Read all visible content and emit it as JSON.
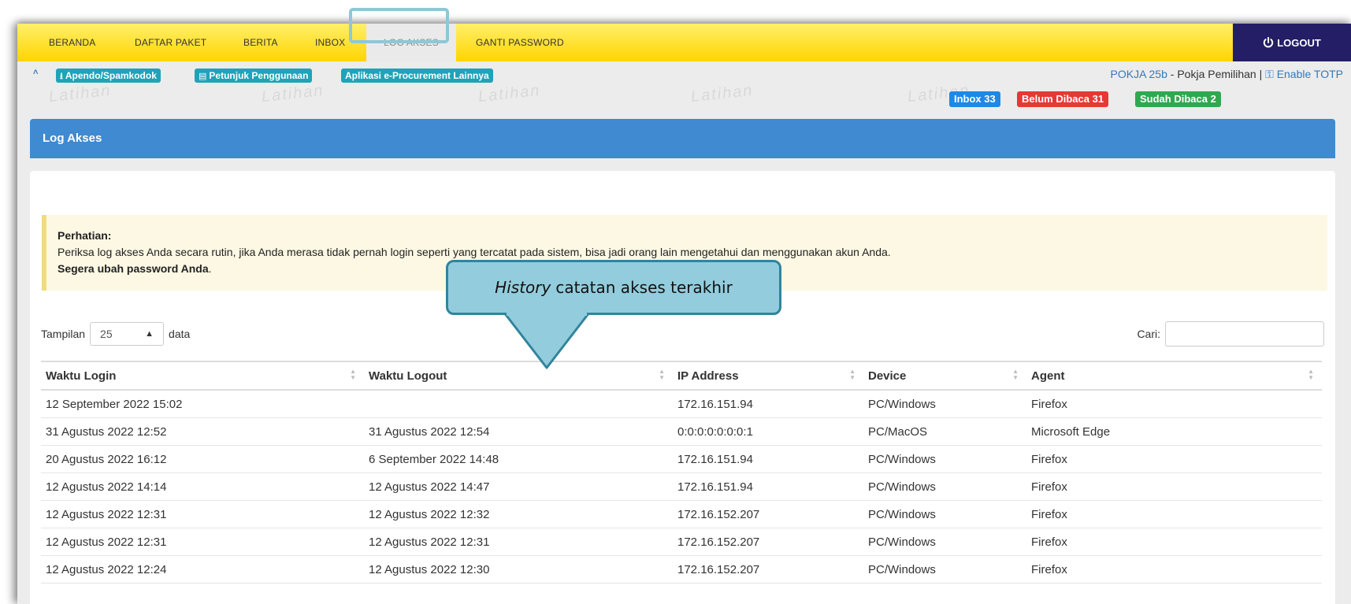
{
  "nav": {
    "items": [
      "BERANDA",
      "DAFTAR PAKET",
      "BERITA",
      "INBOX",
      "LOG AKSES",
      "GANTI PASSWORD"
    ],
    "logout": "LOGOUT"
  },
  "toolbar": {
    "buttons": [
      "Apendo/Spamkodok",
      "Petunjuk Penggunaan",
      "Aplikasi e-Procurement Lainnya"
    ],
    "user_group": "POKJA 25b",
    "user_role": "- Pokja Pemilihan |",
    "enable_totp": "Enable TOTP"
  },
  "watermark": "Latihan",
  "badges": {
    "inbox": "Inbox 33",
    "unread": "Belum Dibaca 31",
    "read": "Sudah Dibaca 2"
  },
  "panel": {
    "title": "Log Akses"
  },
  "alert": {
    "heading": "Perhatian:",
    "message": "Periksa log akses Anda secara rutin, jika Anda merasa tidak pernah login seperti yang tercatat pada sistem, bisa jadi orang lain mengetahui dan menggunakan akun Anda.",
    "emphasis": "Segera ubah password Anda",
    "period": "."
  },
  "table_controls": {
    "length_label": "Tampilan",
    "length_value": "25",
    "length_suffix": "data",
    "search_label": "Cari:"
  },
  "table": {
    "headers": [
      "Waktu Login",
      "Waktu Logout",
      "IP Address",
      "Device",
      "Agent"
    ],
    "rows": [
      [
        "12 September 2022 15:02",
        "",
        "172.16.151.94",
        "PC/Windows",
        "Firefox"
      ],
      [
        "31 Agustus 2022 12:52",
        "31 Agustus 2022 12:54",
        "0:0:0:0:0:0:0:1",
        "PC/MacOS",
        "Microsoft Edge"
      ],
      [
        "20 Agustus 2022 16:12",
        "6 September 2022 14:48",
        "172.16.151.94",
        "PC/Windows",
        "Firefox"
      ],
      [
        "12 Agustus 2022 14:14",
        "12 Agustus 2022 14:47",
        "172.16.151.94",
        "PC/Windows",
        "Firefox"
      ],
      [
        "12 Agustus 2022 12:31",
        "12 Agustus 2022 12:32",
        "172.16.152.207",
        "PC/Windows",
        "Firefox"
      ],
      [
        "12 Agustus 2022 12:31",
        "12 Agustus 2022 12:31",
        "172.16.152.207",
        "PC/Windows",
        "Firefox"
      ],
      [
        "12 Agustus 2022 12:24",
        "12 Agustus 2022 12:30",
        "172.16.152.207",
        "PC/Windows",
        "Firefox"
      ]
    ]
  },
  "callout": {
    "italic": "History",
    "text": "catatan akses terakhir"
  },
  "colors": {
    "navbar": "#ffd400",
    "logout_bg": "#241e66",
    "toolbar_button": "#1fa3b8",
    "panel_header": "#3f8ad0",
    "badge_inbox": "#1e88e5",
    "badge_unread": "#e53935",
    "badge_read": "#2fa84f",
    "callout_fill": "#93cddd",
    "callout_border": "#31849b"
  }
}
